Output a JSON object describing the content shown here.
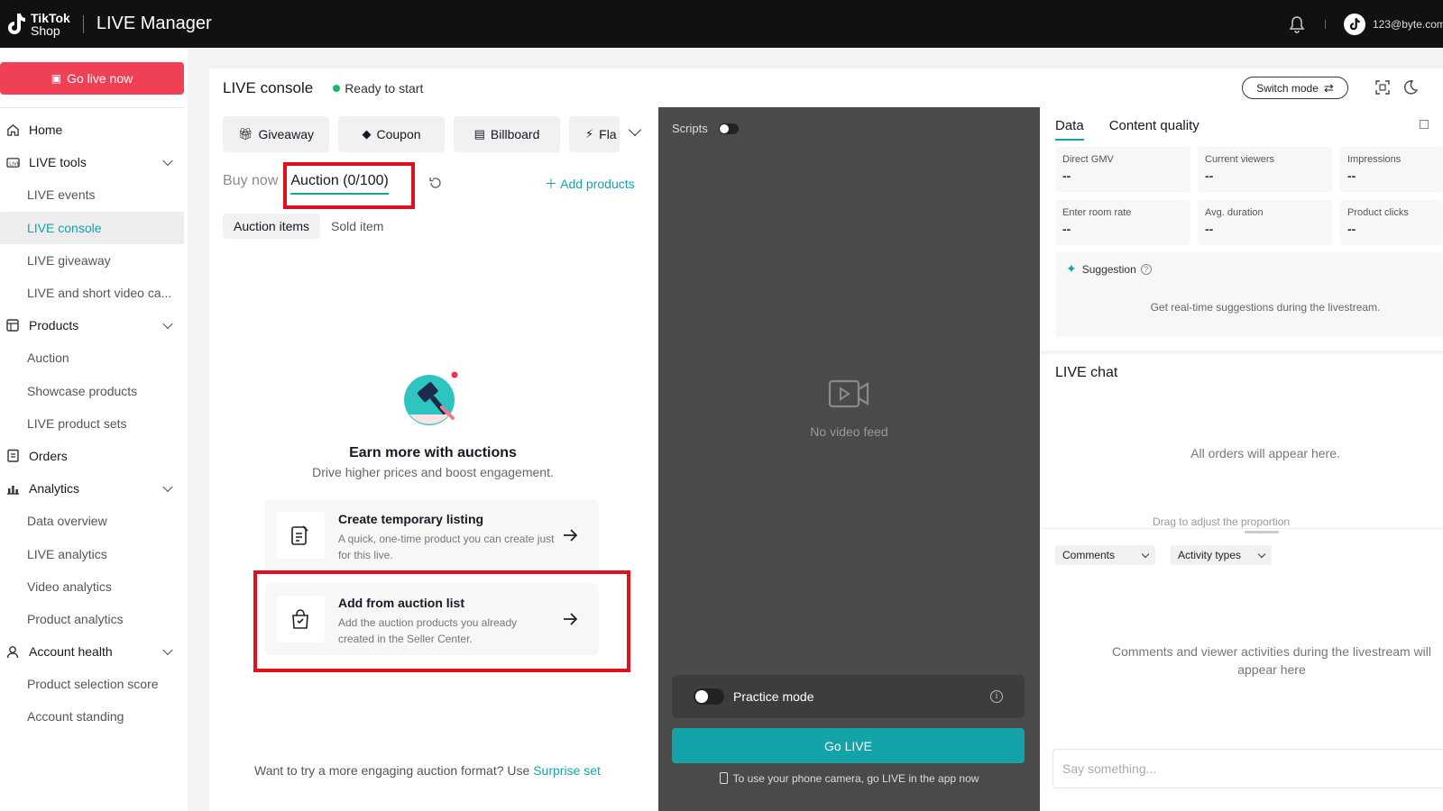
{
  "header": {
    "brand_line1": "TikTok",
    "brand_line2": "Shop",
    "app_title": "LIVE Manager",
    "email": "123@byte.com"
  },
  "sidebar": {
    "go_live_label": "Go live now",
    "items": [
      {
        "label": "Home",
        "icon": "home-icon",
        "type": "top"
      },
      {
        "label": "LIVE tools",
        "icon": "live-tools-icon",
        "type": "group"
      },
      {
        "label": "LIVE events",
        "type": "sub"
      },
      {
        "label": "LIVE console",
        "type": "sub",
        "active": true
      },
      {
        "label": "LIVE giveaway",
        "type": "sub"
      },
      {
        "label": "LIVE and short video ca...",
        "type": "sub"
      },
      {
        "label": "Products",
        "icon": "products-icon",
        "type": "group"
      },
      {
        "label": "Auction",
        "type": "sub"
      },
      {
        "label": "Showcase products",
        "type": "sub"
      },
      {
        "label": "LIVE product sets",
        "type": "sub"
      },
      {
        "label": "Orders",
        "icon": "orders-icon",
        "type": "top"
      },
      {
        "label": "Analytics",
        "icon": "analytics-icon",
        "type": "group"
      },
      {
        "label": "Data overview",
        "type": "sub"
      },
      {
        "label": "LIVE analytics",
        "type": "sub"
      },
      {
        "label": "Video analytics",
        "type": "sub"
      },
      {
        "label": "Product analytics",
        "type": "sub"
      },
      {
        "label": "Account health",
        "icon": "account-health-icon",
        "type": "group"
      },
      {
        "label": "Product selection score",
        "type": "sub"
      },
      {
        "label": "Account standing",
        "type": "sub"
      }
    ]
  },
  "console": {
    "title": "LIVE console",
    "status": "Ready to start",
    "switch_mode": "Switch mode",
    "tools": [
      "Giveaway",
      "Coupon",
      "Billboard",
      "Fla"
    ],
    "tabs": [
      "Buy now",
      "Auction (0/100)"
    ],
    "add_products": "Add products",
    "sub_tabs": [
      "Auction items",
      "Sold item"
    ],
    "empty_title": "Earn more with auctions",
    "empty_subtitle": "Drive higher prices and boost engagement.",
    "options": [
      {
        "title": "Create temporary listing",
        "desc": "A quick, one-time product you can create just for this live."
      },
      {
        "title": "Add from auction list",
        "desc": "Add the auction products you already created in the Seller Center."
      }
    ],
    "footer_prefix": "Want to try a more engaging auction format? Use",
    "footer_link": "Surprise set"
  },
  "video": {
    "scripts_label": "Scripts",
    "no_feed": "No video feed",
    "practice_mode": "Practice mode",
    "go_live": "Go LIVE",
    "phone_note": "To use your phone camera, go LIVE in the app now"
  },
  "right": {
    "tabs": [
      "Data",
      "Content quality"
    ],
    "metrics": [
      {
        "label": "Direct GMV",
        "value": "--"
      },
      {
        "label": "Current viewers",
        "value": "--"
      },
      {
        "label": "Impressions",
        "value": "--"
      },
      {
        "label": "Enter room rate",
        "value": "--"
      },
      {
        "label": "Avg. duration",
        "value": "--"
      },
      {
        "label": "Product clicks",
        "value": "--"
      }
    ],
    "suggestion_title": "Suggestion",
    "suggestion_text": "Get real-time suggestions during the livestream.",
    "chat_title": "LIVE chat",
    "orders_empty": "All orders will appear here.",
    "drag_hint": "Drag to adjust the proportion",
    "filters": [
      "Comments",
      "Activity types"
    ],
    "comments_empty_line1": "Comments and viewer activities during the livestream will",
    "comments_empty_line2": "appear here",
    "say_placeholder": "Say something..."
  }
}
